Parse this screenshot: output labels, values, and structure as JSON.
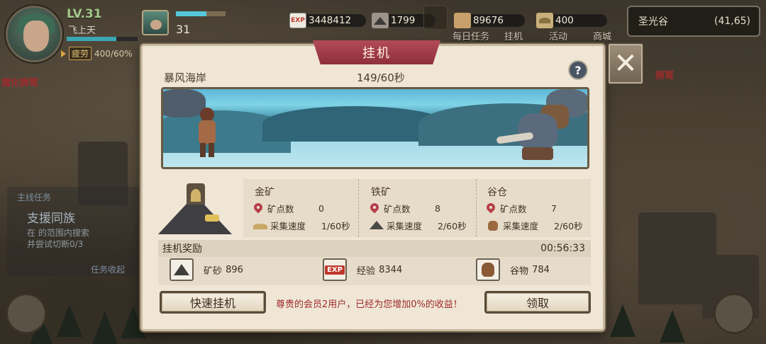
{
  "player": {
    "level": "LV.31",
    "name": "飞上天",
    "fatigue_label": "疲劳",
    "fatigue_value": "400/60%",
    "pet_level": "31"
  },
  "resources": [
    {
      "icon": "exp-icon",
      "value": "3448412"
    },
    {
      "icon": "ore-icon",
      "value": "1799"
    },
    {
      "icon": "grain-sack-icon",
      "value": "89676"
    },
    {
      "icon": "stone-icon",
      "value": "400"
    }
  ],
  "top_menu": {
    "daily": "每日任务",
    "idle": "挂机",
    "event": "活动",
    "shop": "商城"
  },
  "location": {
    "name": "圣光谷",
    "coords": "(41,65)"
  },
  "side": {
    "quest_header": "主线任务",
    "quest_title": "支援同族",
    "quest_line1": "在    的范围内搜索",
    "quest_line2": "    并尝试切断0/3",
    "quest_collapse": "任务收起",
    "left_tag": "魔化狮鹫",
    "right_tag": "狮鹫"
  },
  "modal": {
    "title": "挂机",
    "stage_name": "暴风海岸",
    "stage_progress": "149/60秒",
    "help": "?",
    "close": "✕",
    "columns": [
      {
        "title": "金矿",
        "count_label": "矿点数",
        "count": "0",
        "rate_label": "采集速度",
        "rate": "1/60秒",
        "rate_icon": "gold-ore-icon"
      },
      {
        "title": "铁矿",
        "count_label": "矿点数",
        "count": "8",
        "rate_label": "采集速度",
        "rate": "2/60秒",
        "rate_icon": "iron-ore-icon"
      },
      {
        "title": "谷仓",
        "count_label": "矿点数",
        "count": "7",
        "rate_label": "采集速度",
        "rate": "2/60秒",
        "rate_icon": "grain-icon"
      }
    ],
    "reward_header": "挂机奖励",
    "reward_timer": "00:56:33",
    "rewards": [
      {
        "icon": "ore-icon",
        "label": "矿砂",
        "value": "896"
      },
      {
        "icon": "exp-icon",
        "label": "经验",
        "value": "8344"
      },
      {
        "icon": "grain-sack-icon",
        "label": "谷物",
        "value": "784"
      }
    ],
    "exp_text": "EXP",
    "quick_button": "快速挂机",
    "vip_note": "尊贵的会员2用户，已经为您增加0%的收益！",
    "claim_button": "领取"
  },
  "colors": {
    "title_ribbon": "#a13d4b",
    "vip_note": "#9e2b2b",
    "panel_bg": "#efe6d6"
  }
}
